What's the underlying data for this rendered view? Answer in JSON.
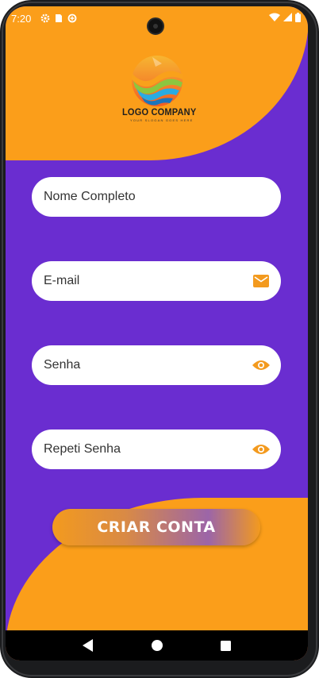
{
  "status_bar": {
    "time": "7:20",
    "left_icons": [
      "settings-icon",
      "sim-card-icon",
      "data-saver-icon"
    ],
    "right_icons": [
      "wifi-icon",
      "signal-icon",
      "battery-icon"
    ]
  },
  "logo": {
    "title": "LOGO COMPANY",
    "tagline": "YOUR SLOGAN GOES HERE"
  },
  "form": {
    "full_name_placeholder": "Nome Completo",
    "email_placeholder": "E-mail",
    "password_placeholder": "Senha",
    "repeat_password_placeholder": "Repeti Senha",
    "email_icon": "mail-icon",
    "password_icon": "eye-icon",
    "repeat_password_icon": "eye-icon"
  },
  "button": {
    "create_account_label": "CRIAR CONTA"
  },
  "nav": {
    "buttons": [
      "back-icon",
      "home-icon",
      "recents-icon"
    ]
  },
  "colors": {
    "primary_orange": "#fb9e1a",
    "background_purple": "#6a2dd0",
    "icon_orange": "#f39a1e",
    "field_white": "#ffffff"
  }
}
